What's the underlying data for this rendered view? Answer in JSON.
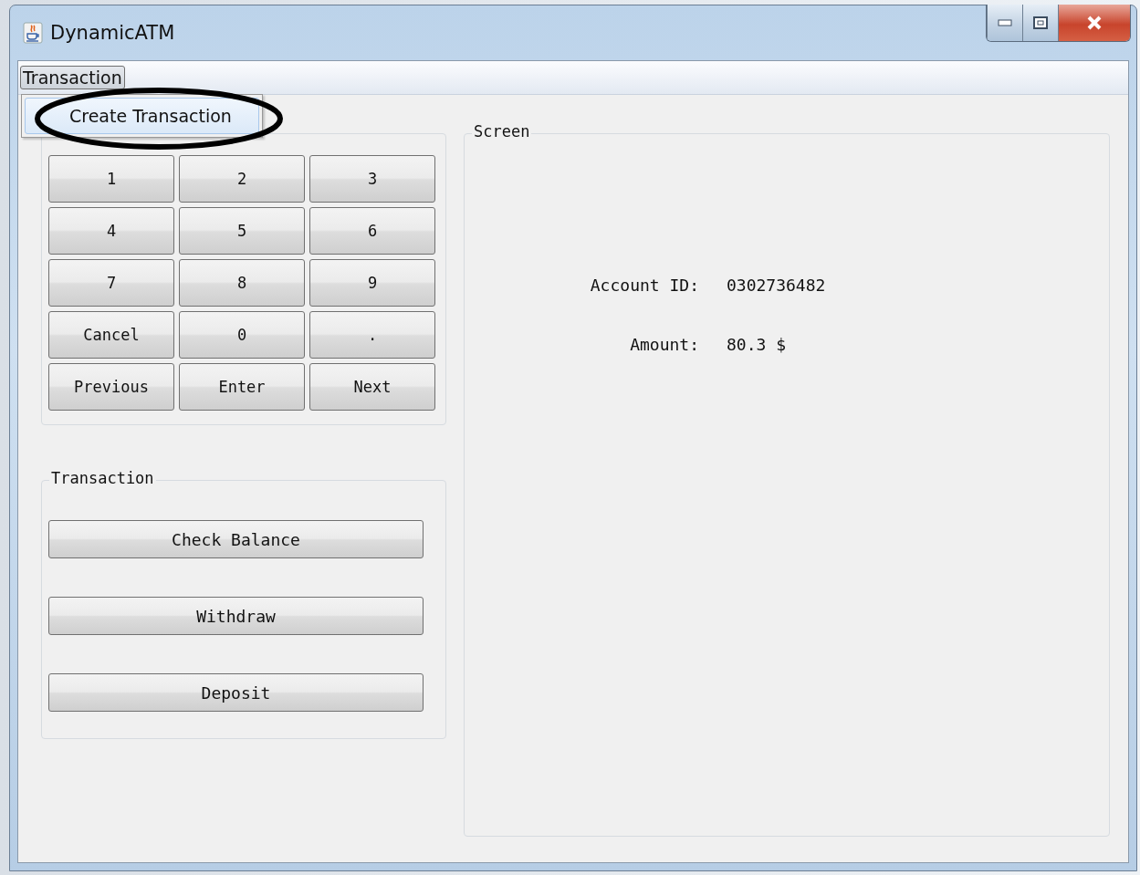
{
  "window": {
    "title": "DynamicATM"
  },
  "menu_bar": [
    {
      "label": "Transaction",
      "selected": true
    }
  ],
  "open_menu": {
    "items": [
      {
        "label": "Create Transaction",
        "selected": true
      }
    ],
    "circled": true
  },
  "keypad": {
    "keys": [
      "1",
      "2",
      "3",
      "4",
      "5",
      "6",
      "7",
      "8",
      "9",
      "Cancel",
      "0",
      ".",
      "Previous",
      "Enter",
      "Next"
    ]
  },
  "transaction_panel": {
    "title": "Transaction",
    "buttons": [
      "Check Balance",
      "Withdraw",
      "Deposit"
    ]
  },
  "screen_panel": {
    "title": "Screen",
    "fields": [
      {
        "label": "Account ID:",
        "value": "0302736482"
      },
      {
        "label": "Amount:",
        "value": "80.3 $"
      }
    ]
  }
}
